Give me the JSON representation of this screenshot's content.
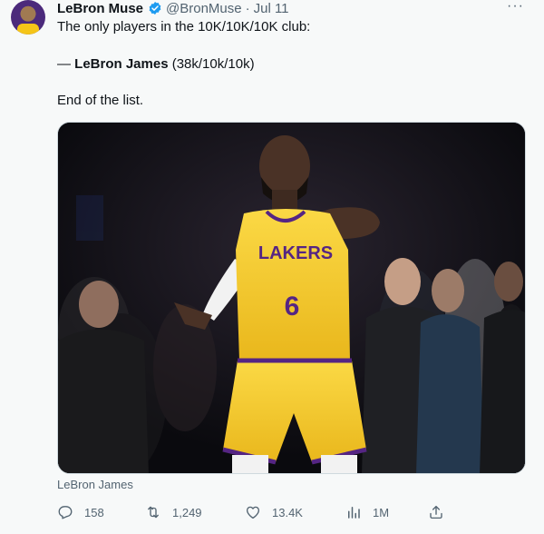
{
  "author": {
    "name": "LeBron Muse",
    "handle": "@BronMuse",
    "separator": "·",
    "date": "Jul 11"
  },
  "more_label": "···",
  "tweet": {
    "line1": "The only players in the 10K/10K/10K club:",
    "line2_prefix": "— ",
    "line2_bold": "LeBron James",
    "line2_rest": " (38k/10k/10k)",
    "line3": "End of the list."
  },
  "media": {
    "jersey_text": "LAKERS",
    "jersey_number": "6",
    "caption": "LeBron James"
  },
  "actions": {
    "replies": "158",
    "retweets": "1,249",
    "likes": "13.4K",
    "views": "1M"
  },
  "colors": {
    "verified": "#1d9bf0",
    "secondary_text": "#536471",
    "lakers_gold": "#f5c518",
    "lakers_purple": "#552583"
  }
}
